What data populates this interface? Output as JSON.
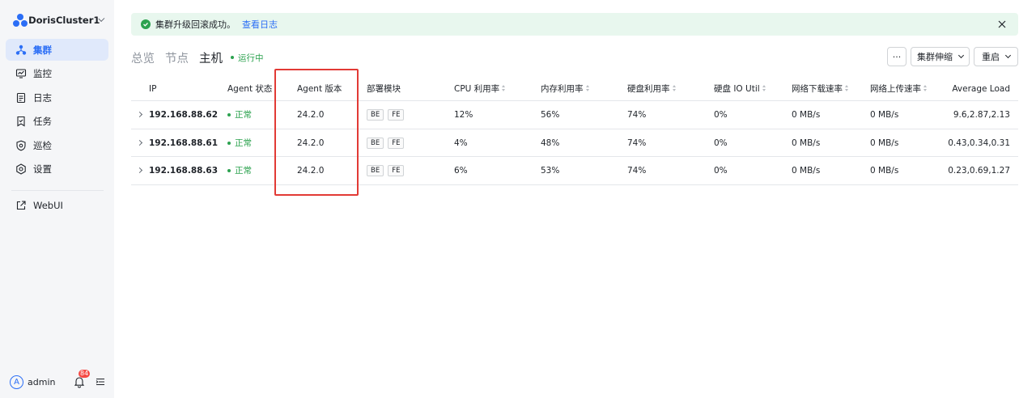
{
  "sidebar": {
    "cluster_name": "DorisCluster1",
    "items": [
      {
        "label": "集群",
        "icon": "cluster-icon",
        "active": true
      },
      {
        "label": "监控",
        "icon": "monitor-icon"
      },
      {
        "label": "日志",
        "icon": "log-icon"
      },
      {
        "label": "任务",
        "icon": "task-icon"
      },
      {
        "label": "巡检",
        "icon": "inspection-icon"
      },
      {
        "label": "设置",
        "icon": "settings-icon"
      }
    ],
    "webui": {
      "label": "WebUI",
      "icon": "external-link-icon"
    },
    "user": {
      "avatar_letter": "A",
      "name": "admin",
      "notification_count": "84"
    }
  },
  "alert": {
    "message": "集群升级回滚成功。",
    "link": "查看日志"
  },
  "tabs": [
    {
      "label": "总览"
    },
    {
      "label": "节点"
    },
    {
      "label": "主机",
      "active": true
    }
  ],
  "status": "运行中",
  "toolbar": {
    "more_label": "···",
    "scale_label": "集群伸缩",
    "restart_label": "重启"
  },
  "table": {
    "columns": {
      "ip": "IP",
      "agent_status": "Agent 状态",
      "agent_version": "Agent 版本",
      "modules": "部署模块",
      "cpu": "CPU 利用率",
      "mem": "内存利用率",
      "disk": "硬盘利用率",
      "disk_io": "硬盘 IO Util",
      "net_down": "网络下载速率",
      "net_up": "网络上传速率",
      "load": "Average Load"
    },
    "rows": [
      {
        "ip": "192.168.88.62",
        "agent_status": "正常",
        "agent_version": "24.2.0",
        "modules": [
          "BE",
          "FE"
        ],
        "cpu": "12%",
        "mem": "56%",
        "disk": "74%",
        "disk_io": "0%",
        "net_down": "0 MB/s",
        "net_up": "0 MB/s",
        "load": "9.6,2.87,2.13"
      },
      {
        "ip": "192.168.88.61",
        "agent_status": "正常",
        "agent_version": "24.2.0",
        "modules": [
          "BE",
          "FE"
        ],
        "cpu": "4%",
        "mem": "48%",
        "disk": "74%",
        "disk_io": "0%",
        "net_down": "0 MB/s",
        "net_up": "0 MB/s",
        "load": "0.43,0.34,0.31"
      },
      {
        "ip": "192.168.88.63",
        "agent_status": "正常",
        "agent_version": "24.2.0",
        "modules": [
          "BE",
          "FE"
        ],
        "cpu": "6%",
        "mem": "53%",
        "disk": "74%",
        "disk_io": "0%",
        "net_down": "0 MB/s",
        "net_up": "0 MB/s",
        "load": "0.23,0.69,1.27"
      }
    ]
  }
}
